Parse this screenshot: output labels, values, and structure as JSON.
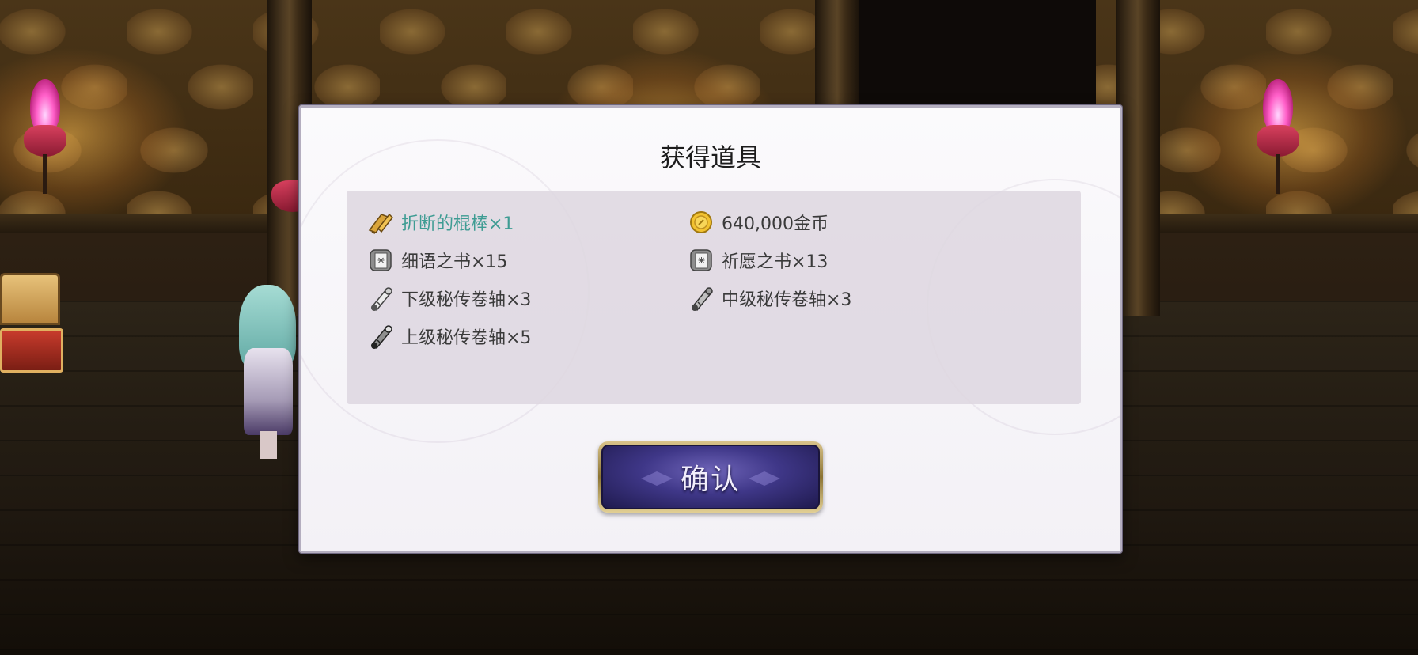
{
  "dialog": {
    "title": "获得道具",
    "confirm_label": "确认"
  },
  "items": [
    {
      "label": "折断的棍棒×1",
      "icon": "broken-club-icon",
      "rare": true
    },
    {
      "label": "640,000金币",
      "icon": "gold-coin-icon",
      "rare": false
    },
    {
      "label": "细语之书×15",
      "icon": "book-icon",
      "rare": false
    },
    {
      "label": "祈愿之书×13",
      "icon": "book-icon",
      "rare": false
    },
    {
      "label": "下级秘传卷轴×3",
      "icon": "scroll-icon",
      "rare": false
    },
    {
      "label": "中级秘传卷轴×3",
      "icon": "scroll-icon",
      "rare": false
    },
    {
      "label": "上级秘传卷轴×5",
      "icon": "scroll-icon",
      "rare": false
    }
  ],
  "colors": {
    "rare_text": "#3e9c93",
    "normal_text": "#3a3a3a",
    "button_inner": "#3f3788",
    "button_frame": "#d9c38a"
  }
}
